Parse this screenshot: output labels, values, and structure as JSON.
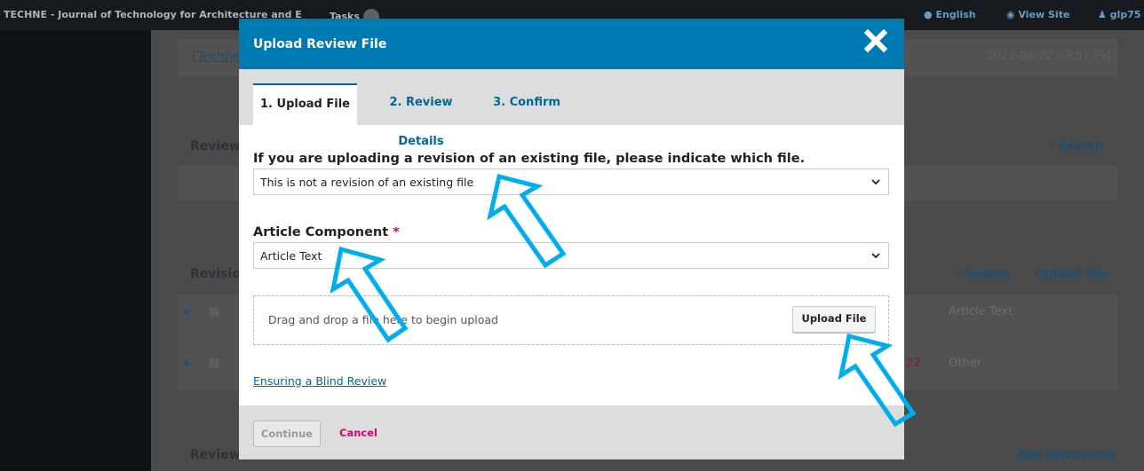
{
  "topbar": {
    "site_title": "TECHNE - Journal of Technology for Architecture and E",
    "tasks_label": "Tasks",
    "language": "English",
    "view_site": "View Site",
    "user": "glp75"
  },
  "background": {
    "breadcrumb_fragment": "[Techne",
    "timestamp": "2022-04-22 03:51 PM",
    "reviewer_panel_title_fragment": "Reviewe",
    "reviewer_search": "Search",
    "revisions_panel_title_fragment": "Revision",
    "revisions_search": "Search",
    "revisions_upload": "Upload File",
    "row1_component": "Article Text",
    "row2_date_fragment": "22",
    "row2_component": "Other",
    "review_panel_title_fragment": "Review",
    "add_discussion": "Add discussion"
  },
  "modal": {
    "title": "Upload Review File",
    "tabs": [
      {
        "label": "1. Upload File",
        "active": true
      },
      {
        "label": "2. Review Details",
        "active": false
      },
      {
        "label": "3. Confirm",
        "active": false
      }
    ],
    "revision_label": "If you are uploading a revision of an existing file, please indicate which file.",
    "revision_value": "This is not a revision of an existing file",
    "component_label": "Article Component",
    "required_marker": "*",
    "component_value": "Article Text",
    "drop_text": "Drag and drop a file here to begin upload",
    "upload_button": "Upload File",
    "blind_review_link": "Ensuring a Blind Review",
    "continue_button": "Continue",
    "cancel_button": "Cancel"
  },
  "colors": {
    "header_blue": "#007ab2",
    "link_blue": "#006798",
    "required_pink": "#d00a6c",
    "annotation_arrow": "#00aeef"
  },
  "icons": [
    "close-icon",
    "chevron-down-icon",
    "globe-icon",
    "eye-icon",
    "user-icon",
    "search-icon",
    "caret-right-icon",
    "file-icon"
  ]
}
